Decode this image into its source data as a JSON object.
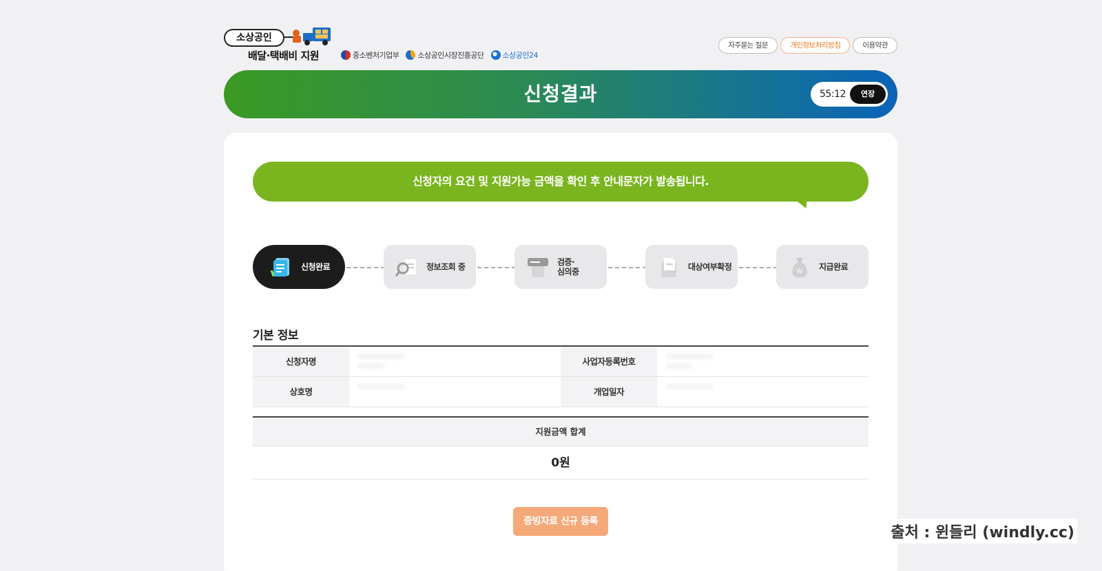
{
  "logo": {
    "top": "소상공인",
    "sub": "배달·택배비 지원"
  },
  "orgs": [
    {
      "name": "중소벤처기업부"
    },
    {
      "name": "소상공인시장진흥공단"
    },
    {
      "name": "소상공인24"
    }
  ],
  "util": {
    "faq": "자주묻는 질문",
    "privacy": "개인정보처리방침",
    "terms": "이용약관"
  },
  "banner": {
    "title": "신청결과",
    "timer": "55:12",
    "extend": "연장"
  },
  "notice": "신청자의 요건 및 지원가능 금액을 확인 후 안내문자가 발송됩니다.",
  "steps": [
    {
      "label": "신청완료",
      "active": true
    },
    {
      "label": "정보조회 중",
      "active": false
    },
    {
      "label": "검증·\n심의중",
      "active": false
    },
    {
      "label": "대상여부확정",
      "active": false
    },
    {
      "label": "지급완료",
      "active": false
    }
  ],
  "basic_info": {
    "title": "기본 정보",
    "applicant_label": "신청자명",
    "bizno_label": "사업자등록번호",
    "company_label": "상호명",
    "opendate_label": "개업일자"
  },
  "sum": {
    "label": "지원금액 합계",
    "value": "0원"
  },
  "register_button": "증빙자료 신규 등록",
  "watermark": "출처 : 윈들리 (windly.cc)",
  "colors": {
    "banner_green": "#3a9a22",
    "banner_blue": "#0b63b8",
    "notice_green": "#7ab520",
    "register_orange": "#f5a878",
    "privacy_orange": "#f07a2a"
  }
}
